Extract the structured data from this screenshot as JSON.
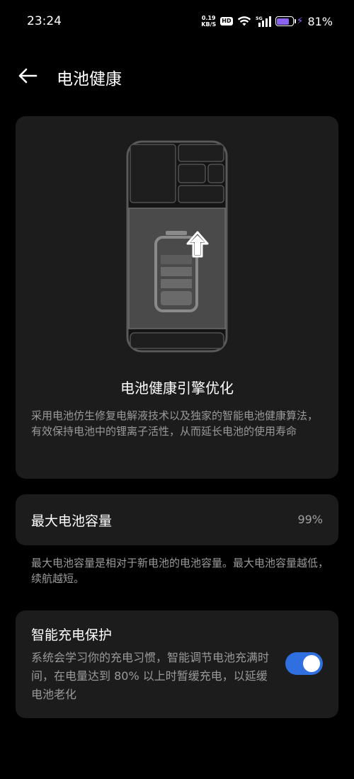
{
  "status_bar": {
    "time": "23:24",
    "net_speed": "0.19",
    "net_unit": "KB/S",
    "hd_badge": "HD",
    "network_type": "5G",
    "battery_percent": "81%",
    "battery_level": 0.81,
    "charging": true,
    "accent_color": "#8a63f0"
  },
  "header": {
    "title": "电池健康",
    "back_icon": "arrow-left-icon"
  },
  "hero": {
    "illustration_icon": "phone-battery-upgrade-icon",
    "title": "电池健康引擎优化",
    "description": "采用电池仿生修复电解液技术以及独家的智能电池健康算法，有效保持电池中的锂离子活性，从而延长电池的使用寿命"
  },
  "capacity": {
    "label": "最大电池容量",
    "value": "99%",
    "note": "最大电池容量是相对于新电池的电池容量。最大电池容量越低，续航越短。"
  },
  "smart_charge": {
    "label": "智能充电保护",
    "description": "系统会学习你的充电习惯，智能调节电池充满时间，在电量达到 80% 以上时暂缓充电，以延缓电池老化",
    "enabled": true,
    "toggle_color": "#2f6fe0"
  }
}
